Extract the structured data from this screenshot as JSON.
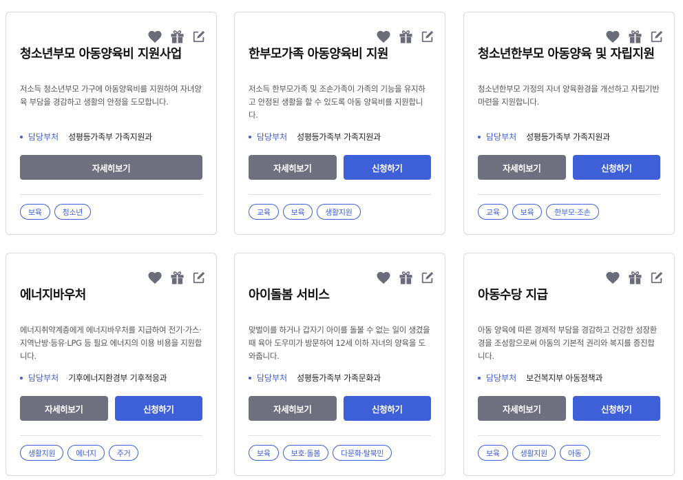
{
  "ui": {
    "dept_label": "담당부처",
    "detail_label": "자세히보기",
    "apply_label": "신청하기"
  },
  "icons": [
    "heart-icon",
    "gift-icon",
    "edit-icon"
  ],
  "colors": {
    "accent": "#3d5fd8",
    "detail_button": "#6e7080",
    "icon": "#6b6c7a"
  },
  "cards": [
    {
      "title": "청소년부모 아동양육비 지원사업",
      "description": "저소득 청소년부모 가구에 아동양육비를 지원하여 자녀양육 부담을 경감하고 생활의 안정을 도모합니다.",
      "department": "성평등가족부 가족지원과",
      "tags": [
        "보육",
        "청소년"
      ],
      "has_apply": false
    },
    {
      "title": "한부모가족 아동양육비 지원",
      "description": "저소득 한부모가족 및 조손가족이 가족의 기능을 유지하고 안정된 생활을 할 수 있도록 아동 양육비를 지원합니다.",
      "department": "성평등가족부 가족지원과",
      "tags": [
        "교육",
        "보육",
        "생활지원"
      ],
      "has_apply": true
    },
    {
      "title": "청소년한부모 아동양육 및 자립지원",
      "description": "청소년한부모 가정의 자녀 양육환경을 개선하고 자립기반 마련을 지원합니다.",
      "department": "성평등가족부 가족지원과",
      "tags": [
        "교육",
        "보육",
        "한부모·조손"
      ],
      "has_apply": true
    },
    {
      "title": "에너지바우처",
      "description": "에너지취약계층에게 에너지바우처를 지급하여 전기·가스·지역난방·등유·LPG 등 필요 에너지의 이용 비용을 지원합니다.",
      "department": "기후에너지환경부 기후적응과",
      "tags": [
        "생활지원",
        "에너지",
        "주거"
      ],
      "has_apply": true
    },
    {
      "title": "아이돌봄 서비스",
      "description": "맞벌이를 하거나 갑자기 아이를 돌볼 수 없는 일이 생겼을 때 육아 도우미가 방문하여 12세 이하 자녀의 양육을 도와줍니다.",
      "department": "성평등가족부 가족문화과",
      "tags": [
        "보육",
        "보호·돌봄",
        "다문화·탈북민"
      ],
      "has_apply": true
    },
    {
      "title": "아동수당 지급",
      "description": "아동 양육에 따른 경제적 부담을 경감하고 건강한 성장환경을 조성함으로써 아동의 기본적 권리와 복지를 증진합니다.",
      "department": "보건복지부 아동정책과",
      "tags": [
        "보육",
        "생활지원",
        "아동"
      ],
      "has_apply": true
    }
  ]
}
